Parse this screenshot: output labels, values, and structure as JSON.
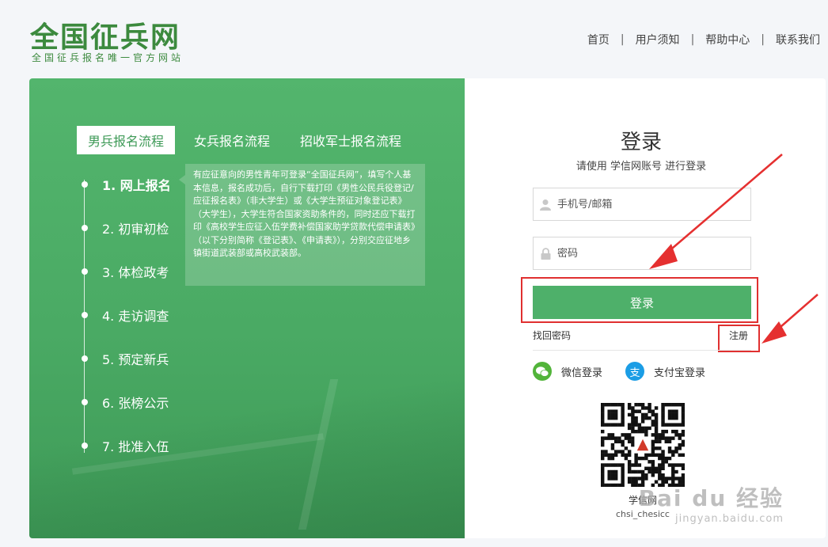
{
  "header": {
    "logo_title": "全国征兵网",
    "logo_subtitle": "全国征兵报名唯一官方网站",
    "nav": [
      {
        "label": "首页"
      },
      {
        "label": "用户须知"
      },
      {
        "label": "帮助中心"
      },
      {
        "label": "联系我们"
      }
    ],
    "nav_separator": "|"
  },
  "process": {
    "tabs": [
      {
        "label": "男兵报名流程",
        "active": true
      },
      {
        "label": "女兵报名流程",
        "active": false
      },
      {
        "label": "招收军士报名流程",
        "active": false
      }
    ],
    "steps": [
      {
        "label": "1. 网上报名",
        "active": true
      },
      {
        "label": "2. 初审初检",
        "active": false
      },
      {
        "label": "3. 体检政考",
        "active": false
      },
      {
        "label": "4. 走访调查",
        "active": false
      },
      {
        "label": "5. 预定新兵",
        "active": false
      },
      {
        "label": "6. 张榜公示",
        "active": false
      },
      {
        "label": "7. 批准入伍",
        "active": false
      }
    ],
    "info_text": "有应征意向的男性青年可登录“全国征兵网”，填写个人基本信息，报名成功后，自行下载打印《男性公民兵役登记/应征报名表》（非大学生）或《大学生预征对象登记表》（大学生），大学生符合国家资助条件的，同时还应下载打印《高校学生应征入伍学费补偿国家助学贷款代偿申请表》（以下分别简称《登记表》、《申请表》），分别交应征地乡镇街道武装部或高校武装部。"
  },
  "login": {
    "title": "登录",
    "subtitle": "请使用 学信网账号 进行登录",
    "username_placeholder": "手机号/邮箱",
    "password_placeholder": "密码",
    "submit_label": "登录",
    "forgot_label": "找回密码",
    "register_label": "注册",
    "wechat_label": "微信登录",
    "alipay_label": "支付宝登录",
    "wechat_icon": "wechat-icon",
    "alipay_icon": "alipay-icon",
    "alipay_glyph": "支",
    "qr_name": "学信网",
    "qr_id": "chsi_chesicc"
  },
  "watermark": {
    "line1": "Bai du 经验",
    "line2": "jingyan.baidu.com"
  },
  "colors": {
    "brand_green": "#3c8a3e",
    "panel_green": "#53b56d",
    "button_green": "#4eb06a",
    "highlight_red": "#e03030",
    "wechat_green": "#52b43a",
    "alipay_blue": "#1b9de5"
  }
}
